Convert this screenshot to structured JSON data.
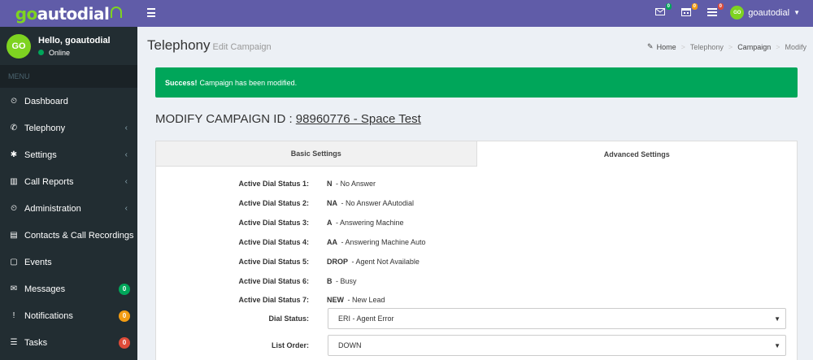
{
  "brand": {
    "logo_go": "go",
    "logo_rest": "autodial"
  },
  "user": {
    "avatar": "GO",
    "greeting": "Hello, goautodial",
    "status": "Online",
    "name": "goautodial"
  },
  "sidebar": {
    "menu_header": "MENU",
    "items": [
      {
        "label": "Dashboard",
        "icon": "dashboard-icon",
        "glyph": "⏲"
      },
      {
        "label": "Telephony",
        "icon": "phone-icon",
        "glyph": "✆",
        "arrow": "‹"
      },
      {
        "label": "Settings",
        "icon": "gear-icon",
        "glyph": "✱",
        "arrow": "‹"
      },
      {
        "label": "Call Reports",
        "icon": "bar-chart-icon",
        "glyph": "▥",
        "arrow": "‹"
      },
      {
        "label": "Administration",
        "icon": "dashboard-icon",
        "glyph": "⏲",
        "arrow": "‹"
      },
      {
        "label": "Contacts & Call Recordings",
        "icon": "address-book-icon",
        "glyph": "▤"
      },
      {
        "label": "Events",
        "icon": "calendar-icon",
        "glyph": "▢"
      },
      {
        "label": "Messages",
        "icon": "envelope-icon",
        "glyph": "✉",
        "badge": "0",
        "badge_color": "#00a65a"
      },
      {
        "label": "Notifications",
        "icon": "exclamation-icon",
        "glyph": "!",
        "badge": "0",
        "badge_color": "#f39c12"
      },
      {
        "label": "Tasks",
        "icon": "tasks-icon",
        "glyph": "☰",
        "badge": "0",
        "badge_color": "#dd4b39"
      }
    ]
  },
  "topbar": {
    "messages_badge": "0",
    "events_badge": "0",
    "tasks_badge": "0"
  },
  "header": {
    "title": "Telephony",
    "subtitle": "Edit Campaign",
    "breadcrumb": {
      "home": "Home",
      "telephony": "Telephony",
      "campaign": "Campaign",
      "modify": "Modify"
    }
  },
  "alert": {
    "strong": "Success!",
    "text": "Campaign has been modified."
  },
  "modify": {
    "prefix": "MODIFY CAMPAIGN ID : ",
    "campaign": "98960776 - Space Test"
  },
  "tabs": {
    "basic": "Basic Settings",
    "advanced": "Advanced Settings"
  },
  "statuses": [
    {
      "label": "Active Dial Status 1:",
      "code": "N",
      "desc": " - No Answer"
    },
    {
      "label": "Active Dial Status 2:",
      "code": "NA",
      "desc": " - No Answer AAutodial"
    },
    {
      "label": "Active Dial Status 3:",
      "code": "A",
      "desc": " - Answering Machine"
    },
    {
      "label": "Active Dial Status 4:",
      "code": "AA",
      "desc": " - Answering Machine Auto"
    },
    {
      "label": "Active Dial Status 5:",
      "code": "DROP",
      "desc": " - Agent Not Available"
    },
    {
      "label": "Active Dial Status 6:",
      "code": "B",
      "desc": " - Busy"
    },
    {
      "label": "Active Dial Status 7:",
      "code": "NEW",
      "desc": " - New Lead"
    }
  ],
  "dial_status": {
    "label": "Dial Status:",
    "value": "ERI - Agent Error"
  },
  "list_order": {
    "label": "List Order:",
    "value": "DOWN"
  },
  "colors": {
    "brand": "#605ca8",
    "sidebar": "#222d32",
    "success": "#00a65a",
    "accent": "#7ed321"
  }
}
